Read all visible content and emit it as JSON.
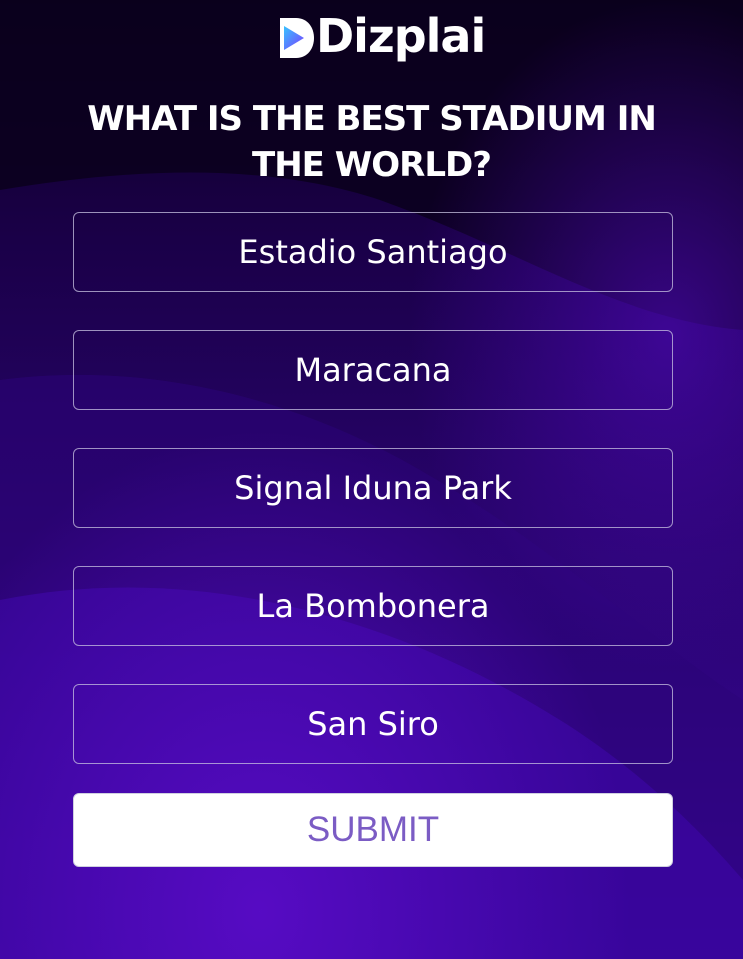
{
  "brand": {
    "logo_text": "Dizplai",
    "logo_icon": "play-triangle-icon"
  },
  "question": {
    "text": "WHAT IS THE BEST STADIUM IN THE WORLD?"
  },
  "options": [
    {
      "label": "Estadio Santiago"
    },
    {
      "label": "Maracana"
    },
    {
      "label": "Signal Iduna Park"
    },
    {
      "label": "La Bombonera"
    },
    {
      "label": "San Siro"
    }
  ],
  "submit": {
    "label": "SUBMIT"
  },
  "colors": {
    "background_dark": "#14003a",
    "background_purple": "#4a06a8",
    "submit_text": "#7b5cc4",
    "logo_gradient_start": "#37c3ff",
    "logo_gradient_end": "#7a3cff"
  }
}
